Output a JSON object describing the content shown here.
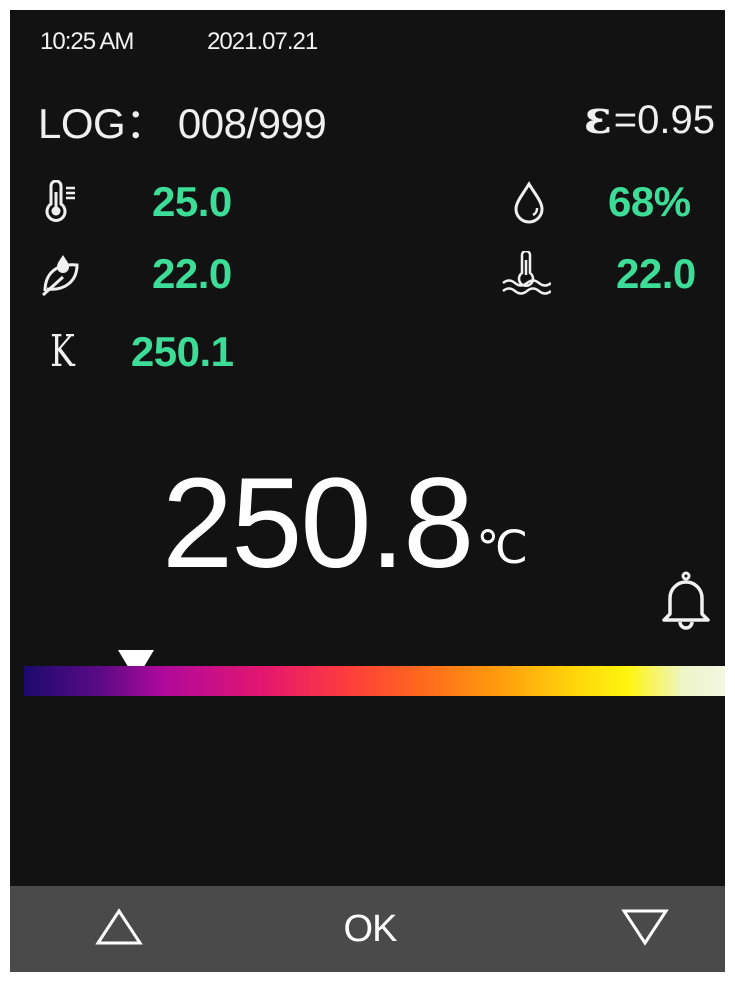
{
  "status": {
    "time": "10:25 AM",
    "date": "2021.07.21"
  },
  "log": {
    "text": "LOG： 008/999"
  },
  "emissivity": {
    "symbol": "ε",
    "value": "=0.95"
  },
  "readings": {
    "ambient_temp": {
      "icon": "thermometer-icon",
      "value": "25.0"
    },
    "humidity": {
      "icon": "water-drop-icon",
      "value": "68%"
    },
    "dew_point": {
      "icon": "leaf-drop-icon",
      "value": "22.0"
    },
    "wet_bulb": {
      "icon": "water-thermometer-icon",
      "value": "22.0"
    },
    "thermocouple": {
      "label": "K",
      "value": "250.1"
    }
  },
  "main_temperature": {
    "value": "250.8",
    "unit": "℃"
  },
  "alarm": {
    "icon": "bell-icon"
  },
  "scale_marker_fraction": 0.16,
  "colors": {
    "background": "#121212",
    "accent": "#3ddc97",
    "bottom_bar": "#4a4a4a"
  },
  "buttons": {
    "up": {
      "icon": "triangle-up-icon"
    },
    "ok": {
      "label": "OK"
    },
    "down": {
      "icon": "triangle-down-icon"
    }
  }
}
